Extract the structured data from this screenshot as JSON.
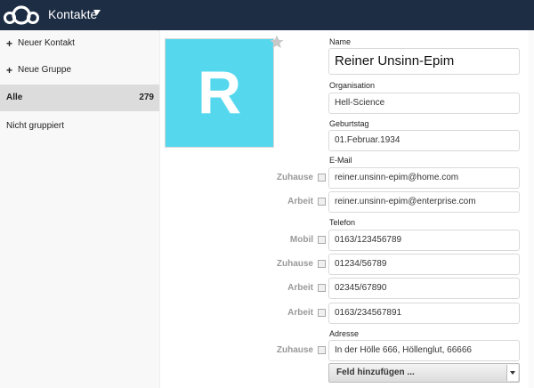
{
  "header": {
    "app_title": "Kontakte"
  },
  "sidebar": {
    "new_contact": "Neuer Kontakt",
    "new_group": "Neue Gruppe",
    "all_label": "Alle",
    "all_count": "279",
    "ungrouped": "Nicht gruppiert"
  },
  "contact": {
    "avatar_letter": "R",
    "avatar_color": "#55d8ee",
    "labels": {
      "name": "Name",
      "organisation": "Organisation",
      "birthday": "Geburtstag",
      "email": "E-Mail",
      "phone": "Telefon",
      "address": "Adresse"
    },
    "name": "Reiner Unsinn-Epim",
    "organisation": "Hell-Science",
    "birthday": "01.Februar.1934",
    "emails": [
      {
        "type": "Zuhause",
        "value": "reiner.unsinn-epim@home.com"
      },
      {
        "type": "Arbeit",
        "value": "reiner.unsinn-epim@enterprise.com"
      }
    ],
    "phones": [
      {
        "type": "Mobil",
        "value": "0163/123456789"
      },
      {
        "type": "Zuhause",
        "value": "01234/56789"
      },
      {
        "type": "Arbeit",
        "value": "02345/67890"
      },
      {
        "type": "Arbeit",
        "value": "0163/234567891"
      }
    ],
    "addresses": [
      {
        "type": "Zuhause",
        "value": "In der Hölle 666, Höllenglut, 66666"
      }
    ],
    "add_field": "Feld hinzufügen ..."
  }
}
